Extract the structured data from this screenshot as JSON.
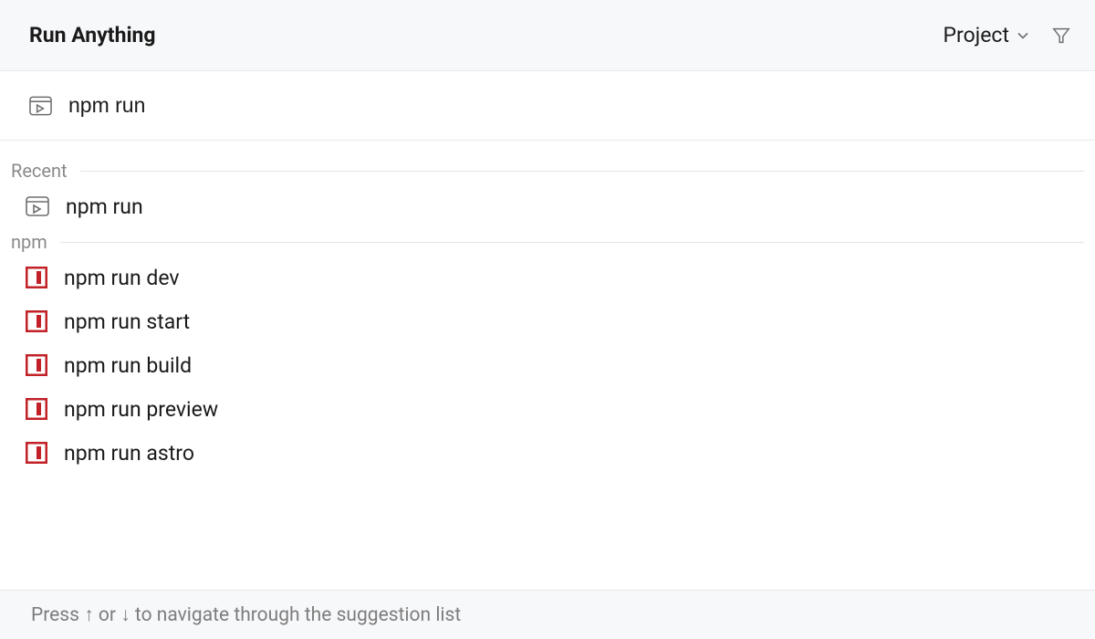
{
  "header": {
    "title": "Run Anything",
    "scope_label": "Project"
  },
  "input": {
    "value": "npm run"
  },
  "sections": {
    "recent": {
      "label": "Recent",
      "items": [
        {
          "label": "npm run"
        }
      ]
    },
    "npm": {
      "label": "npm",
      "items": [
        {
          "label": "npm run dev"
        },
        {
          "label": "npm run start"
        },
        {
          "label": "npm run build"
        },
        {
          "label": "npm run preview"
        },
        {
          "label": "npm run astro"
        }
      ]
    }
  },
  "footer": {
    "hint": "Press ↑ or ↓ to navigate through the suggestion list"
  },
  "colors": {
    "npm_red": "#c12127",
    "terminal_stroke": "#6e6e6e",
    "muted_text": "#8a8a8a",
    "bg_header": "#f7f8fa"
  }
}
